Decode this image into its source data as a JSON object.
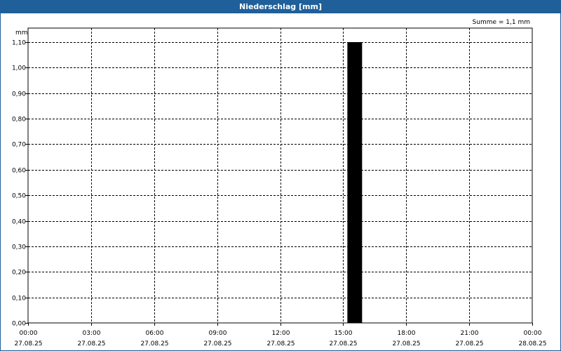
{
  "chart_data": {
    "type": "bar",
    "title": "Niederschlag [mm]",
    "ylabel": "mm",
    "annotation": "Summe = 1,1 mm",
    "ylim": [
      0,
      1.1
    ],
    "yticks": [
      "0,00",
      "0,10",
      "0,20",
      "0,30",
      "0,40",
      "0,50",
      "0,60",
      "0,70",
      "0,80",
      "0,90",
      "1,00",
      "1,10"
    ],
    "xlim_hours": [
      0,
      24
    ],
    "xticks": [
      {
        "time": "00:00",
        "date": "27.08.25"
      },
      {
        "time": "03:00",
        "date": "27.08.25"
      },
      {
        "time": "06:00",
        "date": "27.08.25"
      },
      {
        "time": "09:00",
        "date": "27.08.25"
      },
      {
        "time": "12:00",
        "date": "27.08.25"
      },
      {
        "time": "15:00",
        "date": "27.08.25"
      },
      {
        "time": "18:00",
        "date": "27.08.25"
      },
      {
        "time": "21:00",
        "date": "27.08.25"
      },
      {
        "time": "00:00",
        "date": "28.08.25"
      }
    ],
    "bars": [
      {
        "start_hour": 15.2,
        "end_hour": 15.9,
        "value": 1.1
      }
    ],
    "grid": true,
    "bar_color": "#000000"
  }
}
